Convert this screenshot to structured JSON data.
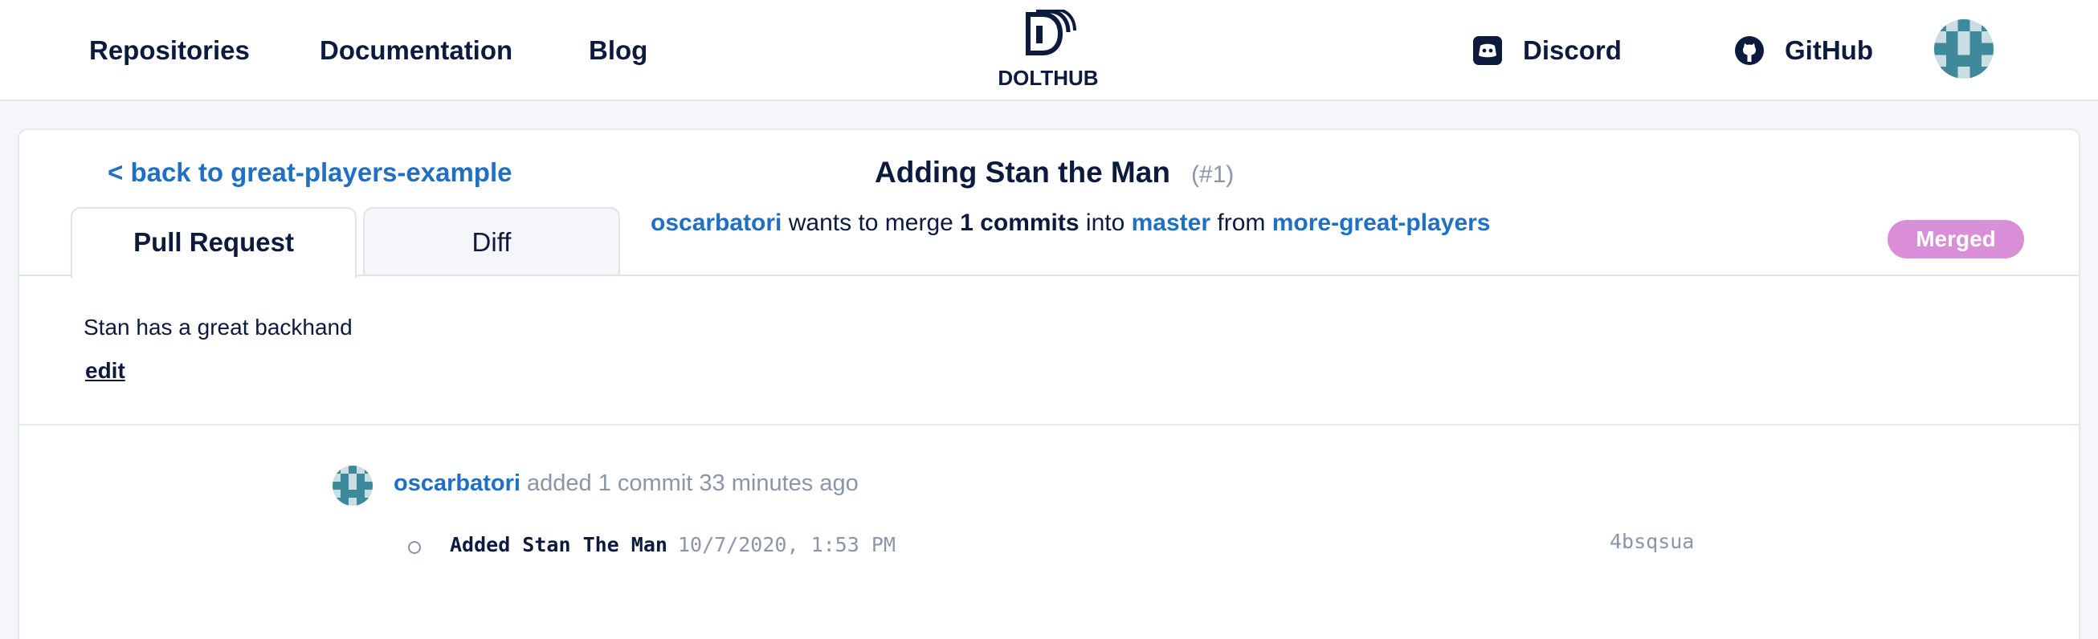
{
  "nav": {
    "repositories": "Repositories",
    "documentation": "Documentation",
    "blog": "Blog",
    "logo_text": "DOLTHUB",
    "discord": "Discord",
    "github": "GitHub"
  },
  "pull_request": {
    "back_link": "< back to great-players-example",
    "title": "Adding Stan the Man",
    "number": "(#1)",
    "tabs": [
      "Pull Request",
      "Diff"
    ],
    "merge_info": {
      "user": "oscarbatori",
      "wants_text": "wants to merge",
      "commit_count": "1 commits",
      "into_text": "into",
      "base_branch": "master",
      "from_text": "from",
      "head_branch": "more-great-players"
    },
    "status": "Merged",
    "description": "Stan has a great backhand",
    "edit_label": "edit"
  },
  "activity": {
    "user": "oscarbatori",
    "text": "added 1 commit 33 minutes ago",
    "commit": {
      "message": "Added Stan The Man",
      "date": "10/7/2020, 1:53 PM",
      "hash": "4bsqsua"
    }
  },
  "colors": {
    "navy": "#0b1a3d",
    "link_blue": "#1f6fc5",
    "merged_badge": "#d98ed7",
    "muted": "#8a96a8",
    "avatar_teal": "#3f8a9a"
  }
}
